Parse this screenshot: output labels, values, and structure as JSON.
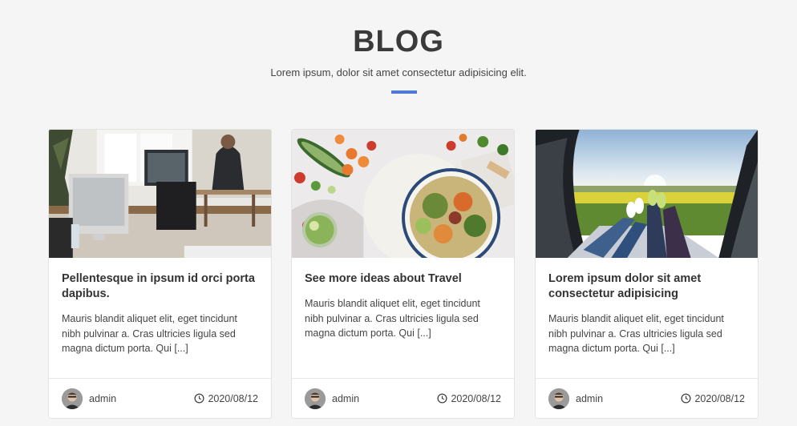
{
  "header": {
    "title": "BLOG",
    "subtitle": "Lorem ipsum, dolor sit amet consectetur adipisicing elit.",
    "accent_color": "#4a78e0"
  },
  "posts": [
    {
      "image": "office-workspace-photo",
      "title": "Pellentesque in ipsum id orci porta dapibus.",
      "excerpt": "Mauris blandit aliquet elit, eget tincidunt nibh pulvinar a. Cras ultricies ligula sed magna dictum porta. Qui [...]",
      "author": "admin",
      "date": "2020/08/12"
    },
    {
      "image": "healthy-food-salad-photo",
      "title": "See more ideas about Travel",
      "excerpt": "Mauris blandit aliquet elit, eget tincidunt nibh pulvinar a. Cras ultricies ligula sed magna dictum porta. Qui [...]",
      "author": "admin",
      "date": "2020/08/12"
    },
    {
      "image": "tent-view-field-photo",
      "title": "Lorem ipsum dolor sit amet consectetur adipisicing",
      "excerpt": "Mauris blandit aliquet elit, eget tincidunt nibh pulvinar a. Cras ultricies ligula sed magna dictum porta. Qui [...]",
      "author": "admin",
      "date": "2020/08/12"
    }
  ]
}
